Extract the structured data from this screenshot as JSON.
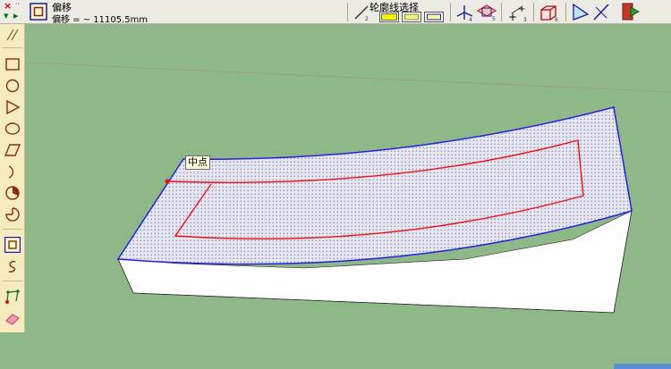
{
  "toolbar": {
    "control_cancel": "×",
    "control_accept": "▾",
    "control_menu": "▸",
    "tool_name": "偏移",
    "measurement_label": "偏移 = ~ 11105.5mm",
    "outline_select_label": "轮廓线选择",
    "icons": [
      "offset-tool-icon",
      "pencil-line-icon",
      "yellow-fill-icon",
      "yellow-outline-icon",
      "section-outline-icon",
      "axes-icon",
      "section-plane-icon",
      "plus-icon",
      "box-icon",
      "triangle-view-icon",
      "line-cross-icon",
      "exit-icon"
    ]
  },
  "leftbar": {
    "tools": [
      "line-tool",
      "rectangle-tool",
      "circle-tool",
      "polygon-tool",
      "ellipse-tool",
      "parallelogram-tool",
      "arc-tool",
      "pie-tool",
      "arc-sector-tool",
      "offset-tool",
      "freehand-tool",
      "move-vertices-tool",
      "eraser-tool"
    ]
  },
  "viewport": {
    "inference_tooltip": "中点"
  },
  "colors": {
    "toolbar_bg": "#ecebe4",
    "leftbar_bg": "#f6ecc0",
    "background": "#8fb888",
    "selection_edge": "#2222dd",
    "offset_preview": "#ee1111",
    "face_white": "#ffffff"
  }
}
